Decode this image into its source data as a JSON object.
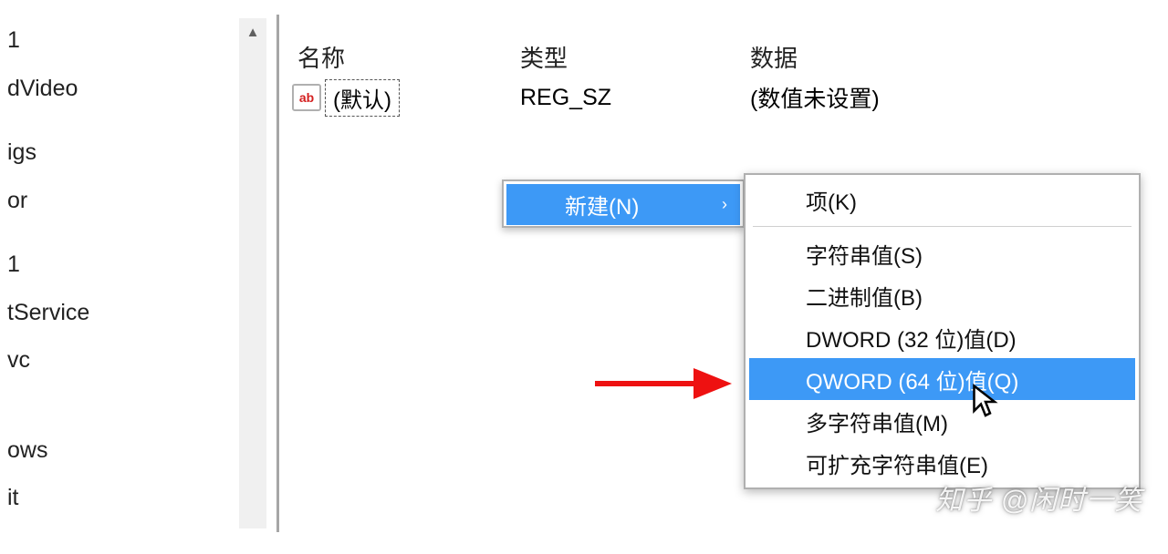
{
  "tree": {
    "items": [
      "1",
      "dVideo",
      "",
      "igs",
      "or",
      "",
      "1",
      "tService",
      "vc",
      "",
      "",
      "ows",
      "it"
    ]
  },
  "columns": {
    "name": "名称",
    "type": "类型",
    "data": "数据"
  },
  "value_row": {
    "icon_text": "ab",
    "name": "(默认)",
    "type": "REG_SZ",
    "data": "(数值未设置)"
  },
  "context_menu": {
    "new_label": "新建(N)",
    "arrow": "›"
  },
  "submenu": {
    "items": [
      {
        "label": "项(K)"
      },
      {
        "sep": true
      },
      {
        "label": "字符串值(S)"
      },
      {
        "label": "二进制值(B)"
      },
      {
        "label": "DWORD (32 位)值(D)"
      },
      {
        "label": "QWORD (64 位)值(Q)",
        "highlight": true
      },
      {
        "label": "多字符串值(M)"
      },
      {
        "label": "可扩充字符串值(E)"
      }
    ]
  },
  "scroll": {
    "up_glyph": "▲"
  },
  "watermark": "知乎 @闲时一笑"
}
